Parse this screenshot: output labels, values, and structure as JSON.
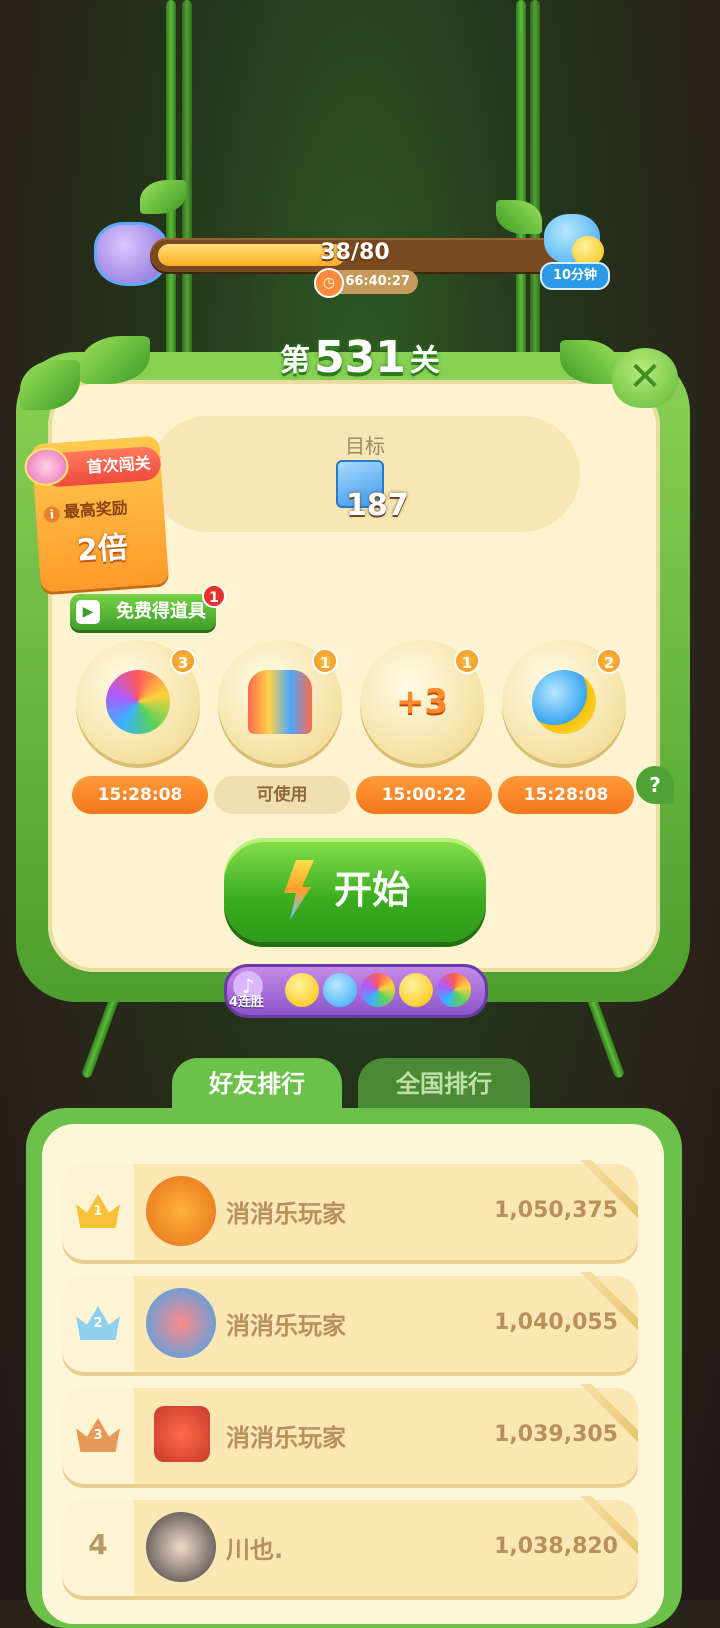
{
  "progress": {
    "text": "38/80",
    "fraction": 0.475,
    "countdown": "66:40:27",
    "reward_time": "10分钟"
  },
  "level": {
    "prefix": "第",
    "number": "531",
    "suffix": "关"
  },
  "goal": {
    "label": "目标",
    "count": "187"
  },
  "first_clear": {
    "title": "首次闯关",
    "line": "最高奖励",
    "multiplier": "2倍"
  },
  "free_props": {
    "label": "免费得道具",
    "badge": "1"
  },
  "boosters": [
    {
      "icon": "rainbow-owl-icon",
      "count": "3",
      "status": "15:28:08",
      "style": "orange"
    },
    {
      "icon": "rocket-icon",
      "count": "1",
      "status": "可使用",
      "style": "tan"
    },
    {
      "icon": "plus-three-moves-icon",
      "count": "1",
      "status": "15:00:22",
      "style": "orange",
      "glyph": "+3"
    },
    {
      "icon": "pet-pair-icon",
      "count": "2",
      "status": "15:28:08",
      "style": "orange"
    }
  ],
  "help_glyph": "?",
  "close_glyph": "✕",
  "start_label": "开始",
  "streak": {
    "label": "4连胜"
  },
  "tabs": {
    "friends": "好友排行",
    "national": "全国排行"
  },
  "rankings": [
    {
      "rank": "1",
      "name": "消消乐玩家",
      "score": "1,050,375"
    },
    {
      "rank": "2",
      "name": "消消乐玩家",
      "score": "1,040,055"
    },
    {
      "rank": "3",
      "name": "消消乐玩家",
      "score": "1,039,305"
    },
    {
      "rank": "4",
      "name": "川也.",
      "score": "1,038,820"
    }
  ],
  "colors": {
    "accent_green": "#3aab1f",
    "orange": "#f4771b",
    "cream": "#fdf4cf"
  }
}
